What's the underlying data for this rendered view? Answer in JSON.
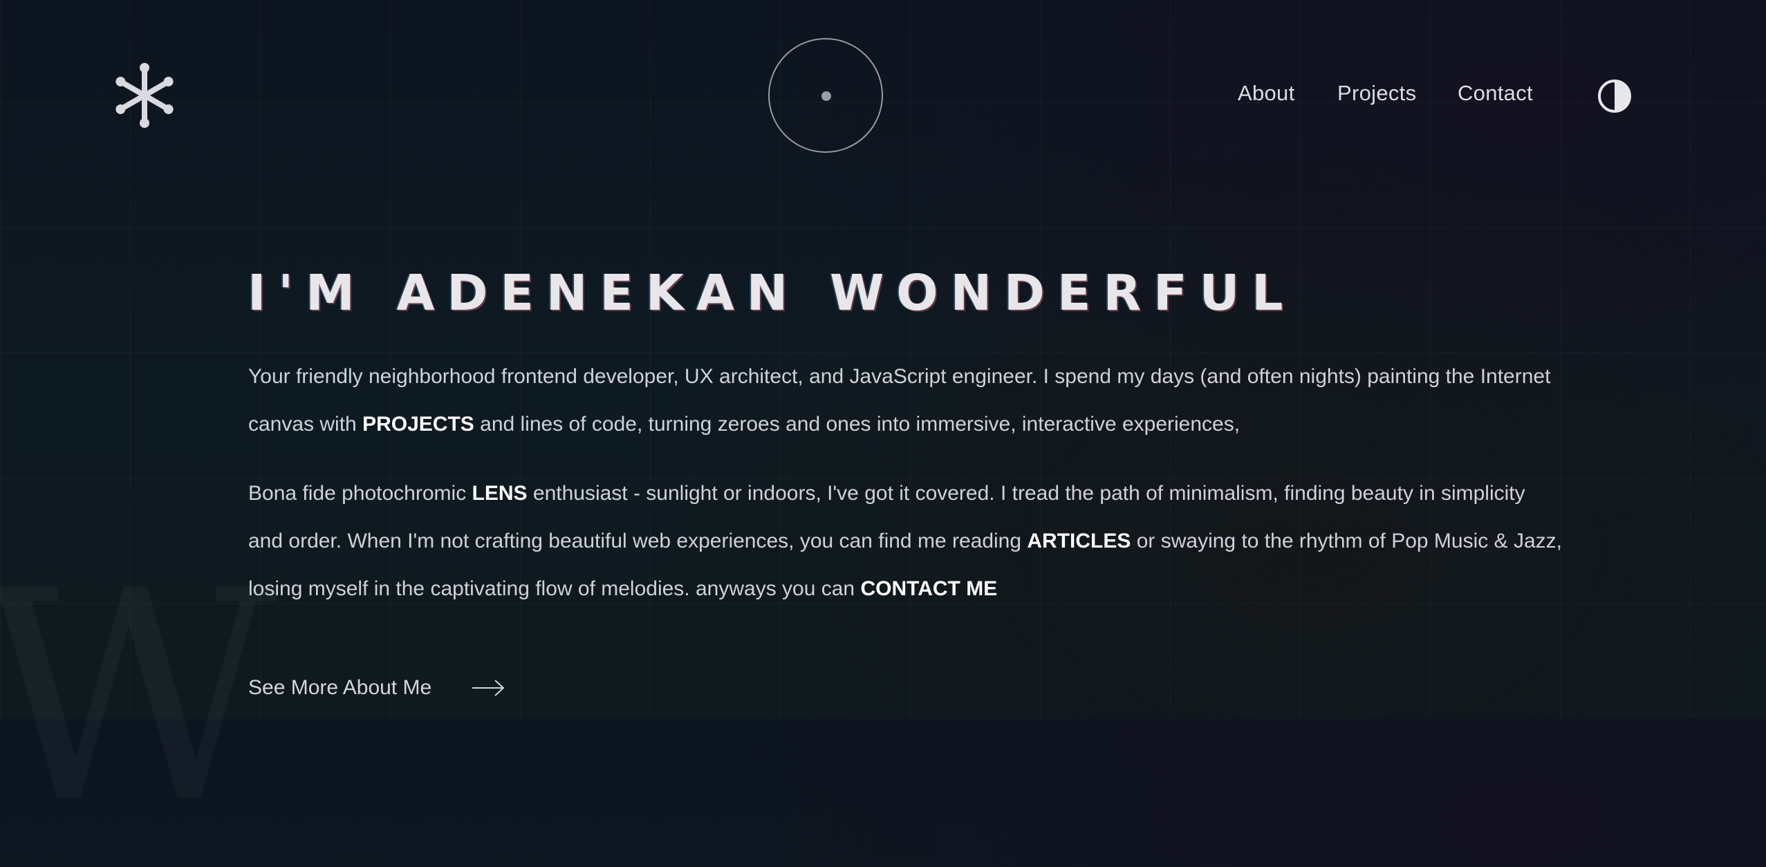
{
  "nav": {
    "about": "About",
    "projects": "Projects",
    "contact": "Contact"
  },
  "hero": {
    "title": "I'M ADENEKAN WONDERFUL",
    "p1_a": "Your friendly neighborhood frontend developer, UX architect, and JavaScript engineer. I spend my days (and often nights) painting the Internet canvas with ",
    "p1_link": "PROJECTS",
    "p1_b": " and lines of code, turning zeroes and ones into immersive, interactive experiences,",
    "p2_a": "Bona fide photochromic ",
    "p2_link1": "LENS",
    "p2_b": " enthusiast - sunlight or indoors, I've got it covered. I tread the path of minimalism, finding beauty in simplicity and order. When I'm not crafting beautiful web experiences, you can find me reading ",
    "p2_link2": "ARTICLES",
    "p2_c": " or swaying to the rhythm of Pop Music & Jazz, losing myself in the captivating flow of melodies. anyways you can ",
    "p2_link3": "CONTACT ME",
    "see_more": "See More About Me"
  },
  "watermark": "W",
  "icons": {
    "logo": "asterisk-logo-icon",
    "orb": "cursor-orb-icon",
    "theme": "half-circle-theme-icon",
    "arrow": "arrow-right-icon"
  },
  "colors": {
    "background": "#0c1420",
    "text": "#cfd2d8",
    "accent": "#ffffff"
  }
}
